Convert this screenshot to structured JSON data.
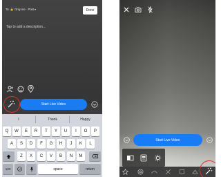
{
  "left": {
    "privacy": "To: 🔒 Only me · Post ▾",
    "done": "Done",
    "placeholder": "Tap to add a description...",
    "live_button": "Start Live Video",
    "suggestions": [
      "I",
      "Thank",
      "Happy"
    ],
    "keys": {
      "row1": [
        "Q",
        "W",
        "E",
        "R",
        "T",
        "Y",
        "U",
        "I",
        "O",
        "P"
      ],
      "row2": [
        "A",
        "S",
        "D",
        "F",
        "G",
        "H",
        "J",
        "K",
        "L"
      ],
      "row3": [
        "Z",
        "X",
        "C",
        "V",
        "B",
        "N",
        "M"
      ],
      "num": "123",
      "space": "space",
      "return": "return"
    }
  },
  "right": {
    "live_button": "Start Live Video"
  },
  "colors": {
    "accent": "#1a7cf5",
    "highlight": "#e0312c"
  },
  "icons": {
    "left": [
      "tag-people-icon",
      "emoji-icon",
      "location-icon",
      "magic-wand-icon",
      "chevron-down-icon",
      "shift-icon",
      "emoji-key-icon",
      "mic-icon",
      "backspace-icon"
    ],
    "right": [
      "close-icon",
      "camera-icon",
      "flash-icon",
      "mask-icon",
      "face-filter-icon",
      "settings-icon",
      "star-icon",
      "effects-icon",
      "magic-wand-icon"
    ]
  }
}
